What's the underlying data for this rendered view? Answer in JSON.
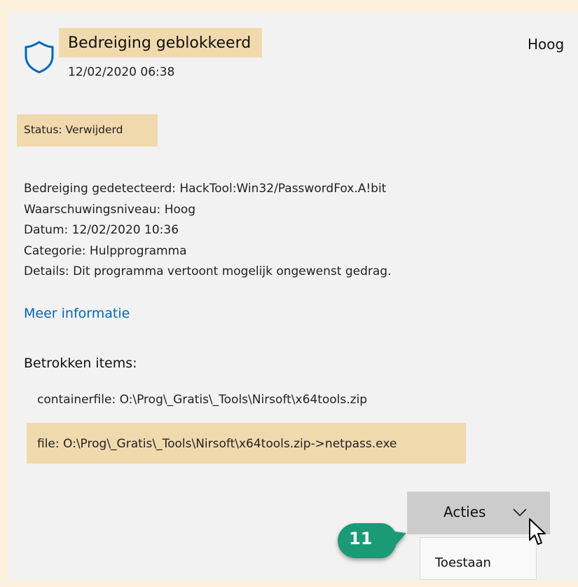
{
  "threat": {
    "title": "Bedreiging geblokkeerd",
    "datetime": "12/02/2020 06:38",
    "severity": "Hoog",
    "shield_icon": "shield-icon"
  },
  "status": {
    "text": "Status:  Verwijderd"
  },
  "details": [
    "Bedreiging gedetecteerd:  HackTool:Win32/PasswordFox.A!bit",
    "Waarschuwingsniveau:  Hoog",
    "Datum:  12/02/2020 10:36",
    "Categorie:  Hulpprogramma",
    "Details:  Dit programma vertoont mogelijk ongewenst gedrag."
  ],
  "more_info_link": "Meer informatie",
  "affected_items": {
    "heading": "Betrokken items:",
    "items": [
      "containerfile: O:\\Prog\\_Gratis\\_Tools\\Nirsoft\\x64tools.zip",
      "file: O:\\Prog\\_Gratis\\_Tools\\Nirsoft\\x64tools.zip->netpass.exe"
    ]
  },
  "actions": {
    "button_label": "Acties",
    "menu_items": [
      "Toestaan"
    ]
  },
  "annotation": {
    "step_number": "11",
    "color": "#1e9a77"
  },
  "colors": {
    "highlight": "#f1d9ae",
    "link": "#0067b8",
    "panel": "#f2f2f2",
    "page": "#fdf0dd"
  }
}
